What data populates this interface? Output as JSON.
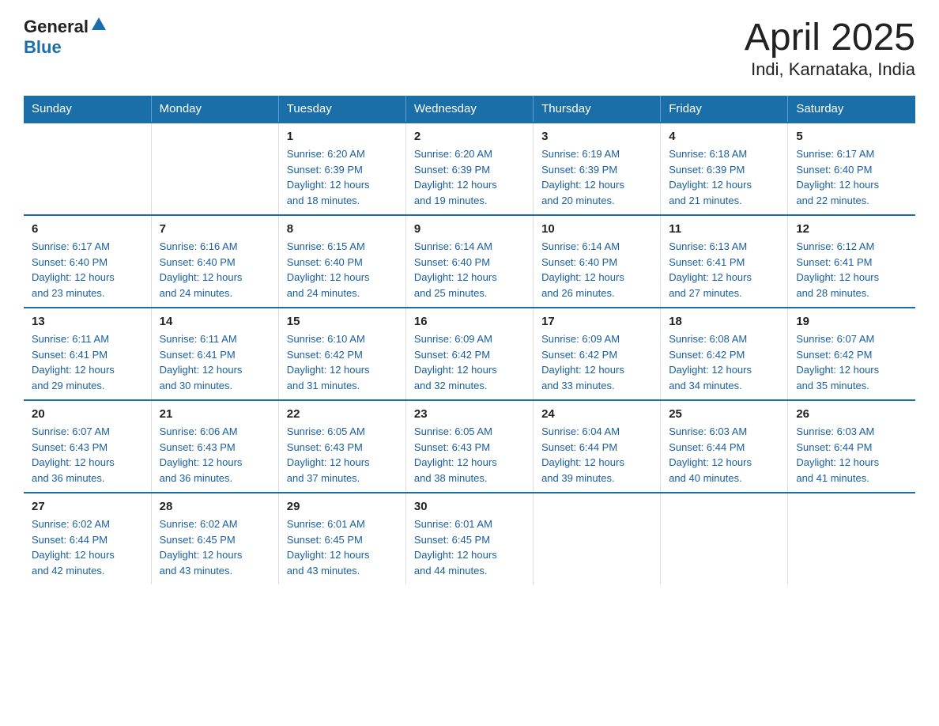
{
  "logo": {
    "general": "General",
    "blue": "Blue"
  },
  "title": "April 2025",
  "subtitle": "Indi, Karnataka, India",
  "days_of_week": [
    "Sunday",
    "Monday",
    "Tuesday",
    "Wednesday",
    "Thursday",
    "Friday",
    "Saturday"
  ],
  "weeks": [
    [
      {
        "day": "",
        "info": ""
      },
      {
        "day": "",
        "info": ""
      },
      {
        "day": "1",
        "info": "Sunrise: 6:20 AM\nSunset: 6:39 PM\nDaylight: 12 hours\nand 18 minutes."
      },
      {
        "day": "2",
        "info": "Sunrise: 6:20 AM\nSunset: 6:39 PM\nDaylight: 12 hours\nand 19 minutes."
      },
      {
        "day": "3",
        "info": "Sunrise: 6:19 AM\nSunset: 6:39 PM\nDaylight: 12 hours\nand 20 minutes."
      },
      {
        "day": "4",
        "info": "Sunrise: 6:18 AM\nSunset: 6:39 PM\nDaylight: 12 hours\nand 21 minutes."
      },
      {
        "day": "5",
        "info": "Sunrise: 6:17 AM\nSunset: 6:40 PM\nDaylight: 12 hours\nand 22 minutes."
      }
    ],
    [
      {
        "day": "6",
        "info": "Sunrise: 6:17 AM\nSunset: 6:40 PM\nDaylight: 12 hours\nand 23 minutes."
      },
      {
        "day": "7",
        "info": "Sunrise: 6:16 AM\nSunset: 6:40 PM\nDaylight: 12 hours\nand 24 minutes."
      },
      {
        "day": "8",
        "info": "Sunrise: 6:15 AM\nSunset: 6:40 PM\nDaylight: 12 hours\nand 24 minutes."
      },
      {
        "day": "9",
        "info": "Sunrise: 6:14 AM\nSunset: 6:40 PM\nDaylight: 12 hours\nand 25 minutes."
      },
      {
        "day": "10",
        "info": "Sunrise: 6:14 AM\nSunset: 6:40 PM\nDaylight: 12 hours\nand 26 minutes."
      },
      {
        "day": "11",
        "info": "Sunrise: 6:13 AM\nSunset: 6:41 PM\nDaylight: 12 hours\nand 27 minutes."
      },
      {
        "day": "12",
        "info": "Sunrise: 6:12 AM\nSunset: 6:41 PM\nDaylight: 12 hours\nand 28 minutes."
      }
    ],
    [
      {
        "day": "13",
        "info": "Sunrise: 6:11 AM\nSunset: 6:41 PM\nDaylight: 12 hours\nand 29 minutes."
      },
      {
        "day": "14",
        "info": "Sunrise: 6:11 AM\nSunset: 6:41 PM\nDaylight: 12 hours\nand 30 minutes."
      },
      {
        "day": "15",
        "info": "Sunrise: 6:10 AM\nSunset: 6:42 PM\nDaylight: 12 hours\nand 31 minutes."
      },
      {
        "day": "16",
        "info": "Sunrise: 6:09 AM\nSunset: 6:42 PM\nDaylight: 12 hours\nand 32 minutes."
      },
      {
        "day": "17",
        "info": "Sunrise: 6:09 AM\nSunset: 6:42 PM\nDaylight: 12 hours\nand 33 minutes."
      },
      {
        "day": "18",
        "info": "Sunrise: 6:08 AM\nSunset: 6:42 PM\nDaylight: 12 hours\nand 34 minutes."
      },
      {
        "day": "19",
        "info": "Sunrise: 6:07 AM\nSunset: 6:42 PM\nDaylight: 12 hours\nand 35 minutes."
      }
    ],
    [
      {
        "day": "20",
        "info": "Sunrise: 6:07 AM\nSunset: 6:43 PM\nDaylight: 12 hours\nand 36 minutes."
      },
      {
        "day": "21",
        "info": "Sunrise: 6:06 AM\nSunset: 6:43 PM\nDaylight: 12 hours\nand 36 minutes."
      },
      {
        "day": "22",
        "info": "Sunrise: 6:05 AM\nSunset: 6:43 PM\nDaylight: 12 hours\nand 37 minutes."
      },
      {
        "day": "23",
        "info": "Sunrise: 6:05 AM\nSunset: 6:43 PM\nDaylight: 12 hours\nand 38 minutes."
      },
      {
        "day": "24",
        "info": "Sunrise: 6:04 AM\nSunset: 6:44 PM\nDaylight: 12 hours\nand 39 minutes."
      },
      {
        "day": "25",
        "info": "Sunrise: 6:03 AM\nSunset: 6:44 PM\nDaylight: 12 hours\nand 40 minutes."
      },
      {
        "day": "26",
        "info": "Sunrise: 6:03 AM\nSunset: 6:44 PM\nDaylight: 12 hours\nand 41 minutes."
      }
    ],
    [
      {
        "day": "27",
        "info": "Sunrise: 6:02 AM\nSunset: 6:44 PM\nDaylight: 12 hours\nand 42 minutes."
      },
      {
        "day": "28",
        "info": "Sunrise: 6:02 AM\nSunset: 6:45 PM\nDaylight: 12 hours\nand 43 minutes."
      },
      {
        "day": "29",
        "info": "Sunrise: 6:01 AM\nSunset: 6:45 PM\nDaylight: 12 hours\nand 43 minutes."
      },
      {
        "day": "30",
        "info": "Sunrise: 6:01 AM\nSunset: 6:45 PM\nDaylight: 12 hours\nand 44 minutes."
      },
      {
        "day": "",
        "info": ""
      },
      {
        "day": "",
        "info": ""
      },
      {
        "day": "",
        "info": ""
      }
    ]
  ]
}
